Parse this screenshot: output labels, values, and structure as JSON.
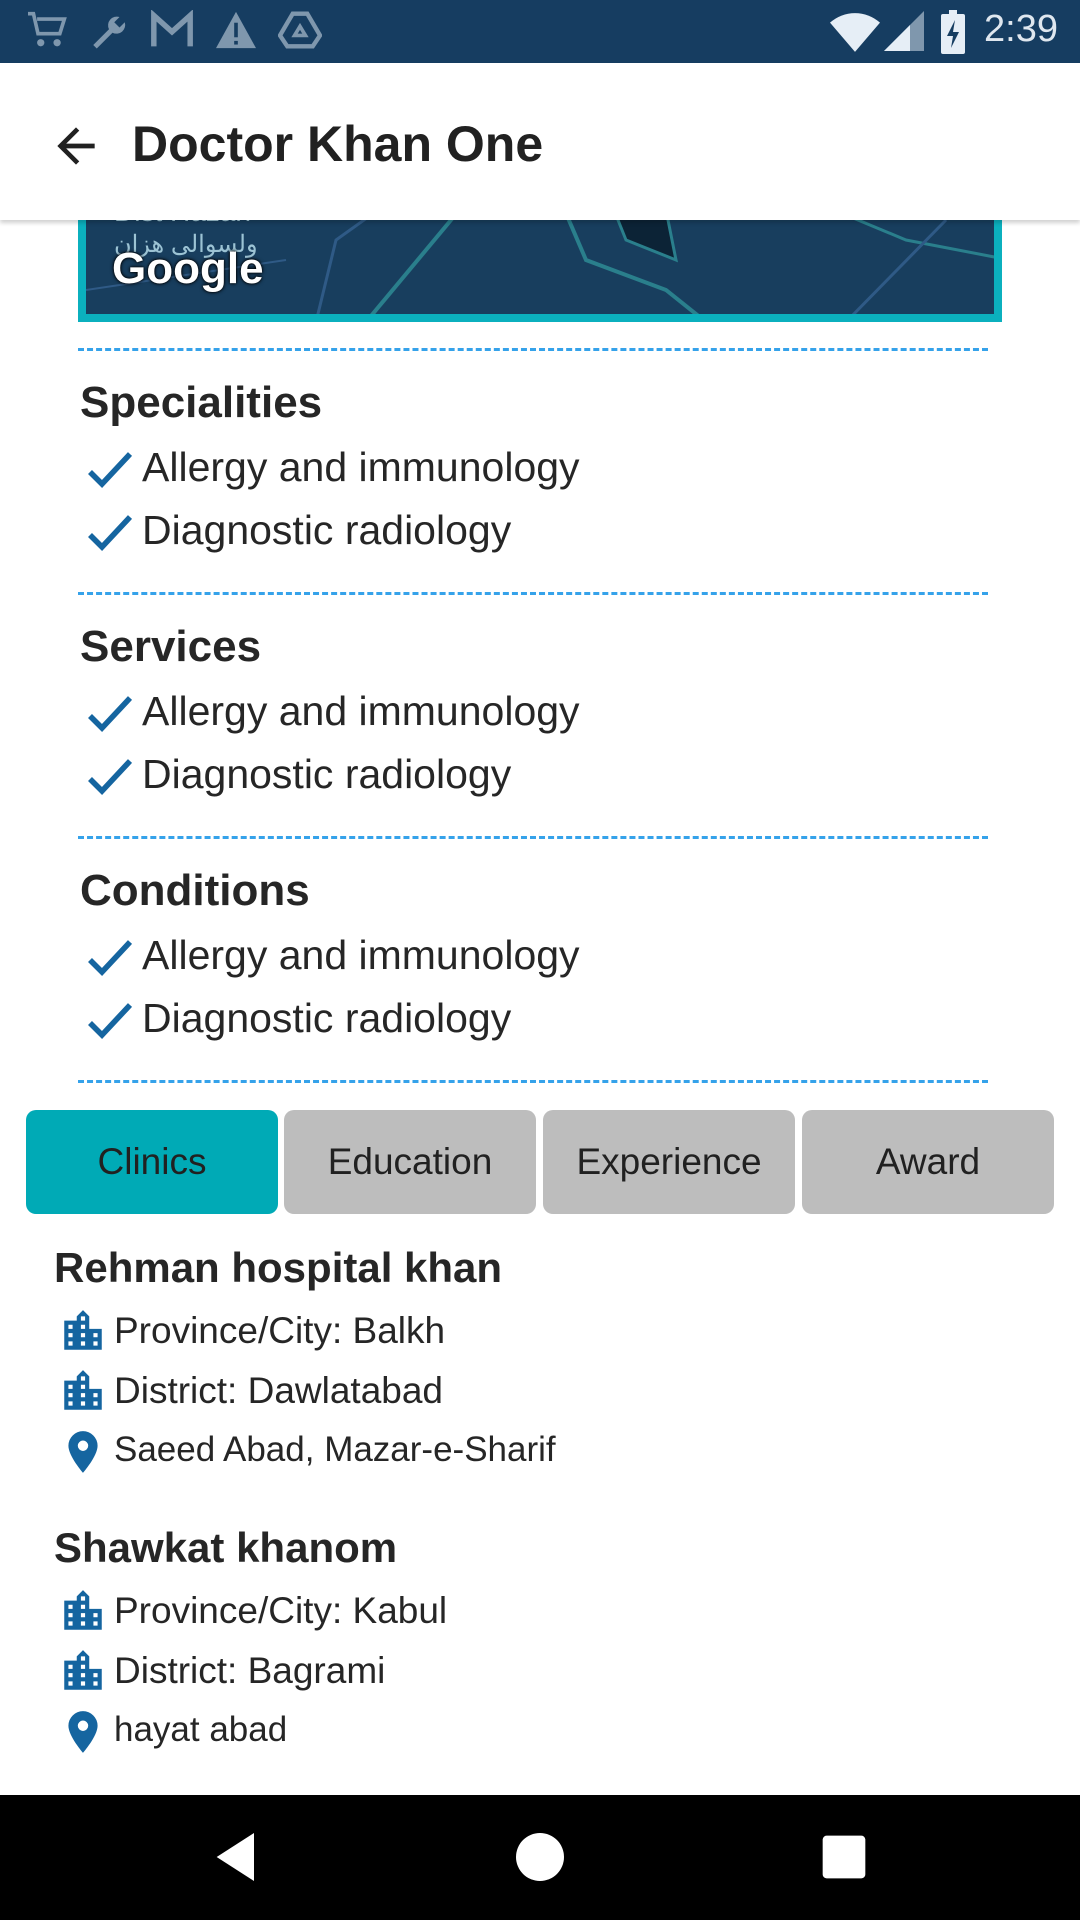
{
  "status_bar": {
    "time": "2:39",
    "left_icons": [
      "cart-icon",
      "wrench-icon",
      "gmail-icon",
      "warning-icon",
      "drive-icon"
    ],
    "right_icons": [
      "wifi-icon",
      "signal-icon",
      "battery-icon"
    ]
  },
  "app_bar": {
    "title": "Doctor Khan One",
    "back_icon": "arrow-back-icon"
  },
  "map": {
    "google_label": "Google",
    "place_text": "Dist Hazan",
    "place_text_local": "ولسوالی هزان"
  },
  "sections": [
    {
      "title": "Specialities",
      "items": [
        "Allergy and immunology",
        "Diagnostic radiology"
      ]
    },
    {
      "title": "Services",
      "items": [
        "Allergy and immunology",
        "Diagnostic radiology"
      ]
    },
    {
      "title": "Conditions",
      "items": [
        "Allergy and immunology",
        "Diagnostic radiology"
      ]
    }
  ],
  "tabs": [
    {
      "label": "Clinics",
      "active": true
    },
    {
      "label": "Education",
      "active": false
    },
    {
      "label": "Experience",
      "active": false
    },
    {
      "label": "Award",
      "active": false
    }
  ],
  "clinics": [
    {
      "name": "Rehman hospital khan",
      "province": "Province/City: Balkh",
      "district": "District: Dawlatabad",
      "address": "Saeed Abad, Mazar-e-Sharif"
    },
    {
      "name": "Shawkat khanom",
      "province": "Province/City: Kabul",
      "district": "District: Bagrami",
      "address": "hayat abad"
    }
  ],
  "colors": {
    "accent": "#00aab6",
    "icon_blue": "#1565a0",
    "divider": "#35a2ea",
    "status_bar": "#163d61"
  }
}
